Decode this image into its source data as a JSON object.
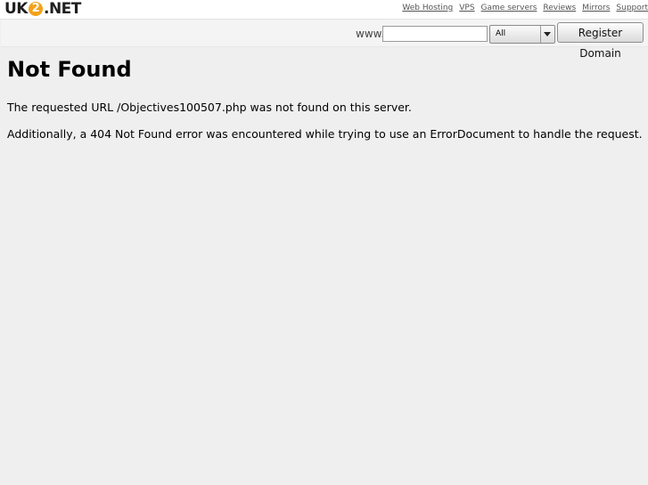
{
  "header": {
    "logo_prefix": "UK",
    "logo_digit": "2",
    "logo_suffix": ".NET",
    "links": [
      "Web Hosting",
      "VPS",
      "Game servers",
      "Reviews",
      "Mirrors",
      "Support"
    ]
  },
  "search": {
    "prefix": "www.",
    "input_value": "",
    "tld_selected": "All",
    "button_label": "Register Domain"
  },
  "main": {
    "title": "Not Found",
    "message1": "The requested URL /Objectives100507.php was not found on this server.",
    "message2": "Additionally, a 404 Not Found error was encountered while trying to use an ErrorDocument to handle the request."
  },
  "colors": {
    "background": "#efefef",
    "accent": "#f2a21b"
  }
}
